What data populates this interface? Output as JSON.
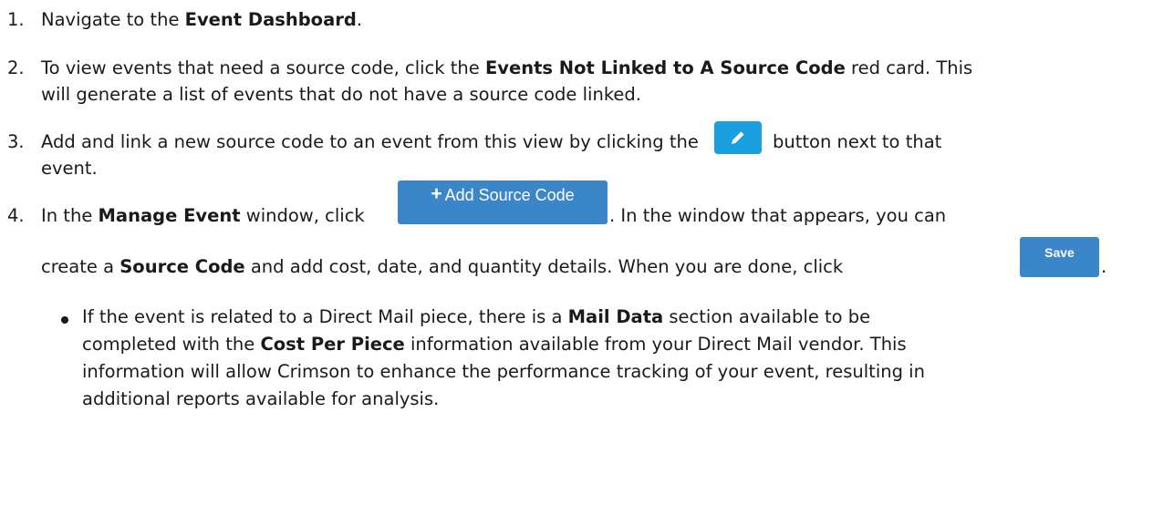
{
  "steps": [
    {
      "number": "1.",
      "pre": "Navigate to the ",
      "bold": "Event Dashboard",
      "post": "."
    },
    {
      "number": "2.",
      "pre": "To view events that need a source code, click the ",
      "bold": "Events Not Linked to A Source Code",
      "post": " red card. This",
      "line2": "will generate a list of events that do not have a source code linked."
    },
    {
      "number": "3.",
      "pre": "Add and link a new source code to an event from this view by clicking the ",
      "post": "button next to that",
      "line2": "event.",
      "button_icon": "pencil-icon"
    },
    {
      "number": "4.",
      "pre": "In the ",
      "bold": "Manage Event",
      "post": " window, click ",
      "post2": ". In the window that appears, you can",
      "line2_pre": "create a ",
      "line2_bold": "Source Code",
      "line2_post": " and add cost, date, and quantity details. When you are done, click ",
      "line2_end": "."
    }
  ],
  "add_source_code_button": {
    "icon": "plus-icon",
    "plus": "+",
    "label": "Add Source Code"
  },
  "save_button": {
    "label": "Save"
  },
  "bullet": {
    "l1_pre": "If the event is related to a Direct Mail piece, there is a ",
    "l1_bold": "Mail Data",
    "l1_post": " section available to be",
    "l2_pre": "completed with the ",
    "l2_bold": "Cost Per Piece",
    "l2_post": " information available from your Direct Mail vendor. This",
    "l3": "information will allow Crimson to enhance the performance tracking of your event, resulting in",
    "l4": "additional reports available for analysis."
  },
  "colors": {
    "edit_button": "#1a9fe0",
    "primary_button": "#3a86c8",
    "text": "#1a1a1a"
  }
}
